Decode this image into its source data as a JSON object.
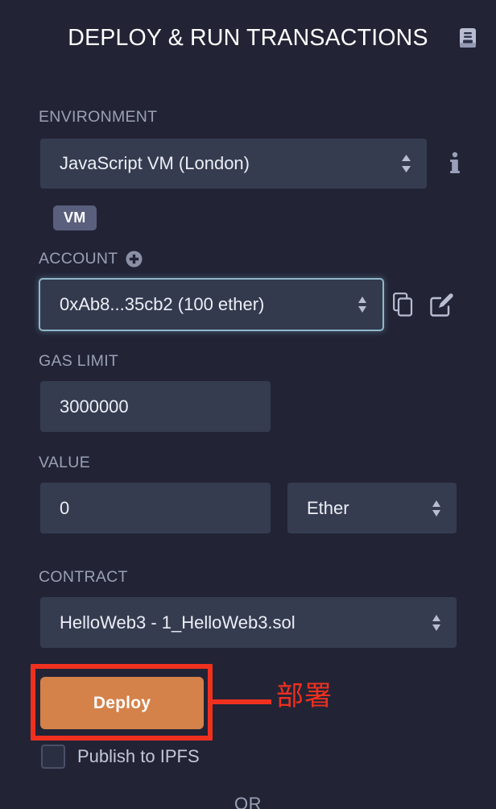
{
  "header": {
    "title": "DEPLOY & RUN TRANSACTIONS",
    "doc_icon": "book-icon"
  },
  "environment": {
    "label": "ENVIRONMENT",
    "value": "JavaScript VM (London)",
    "info_icon": "info-icon",
    "badge": "VM"
  },
  "account": {
    "label": "ACCOUNT",
    "add_icon": "plus-circle-icon",
    "value": "0xAb8...35cb2 (100 ether)",
    "copy_icon": "copy-icon",
    "edit_icon": "edit-icon"
  },
  "gas_limit": {
    "label": "GAS LIMIT",
    "value": "3000000"
  },
  "value": {
    "label": "VALUE",
    "amount": "0",
    "unit": "Ether"
  },
  "contract": {
    "label": "CONTRACT",
    "value": "HelloWeb3 - 1_HelloWeb3.sol"
  },
  "deploy": {
    "label": "Deploy"
  },
  "ipfs": {
    "label": "Publish to IPFS",
    "checked": false
  },
  "divider": {
    "or_label": "OR"
  },
  "annotation": {
    "text": "部署",
    "color": "#f0301f"
  },
  "colors": {
    "background": "#222436",
    "control_background": "#363c50",
    "label": "#9aa0b4",
    "text": "#eceef5",
    "deploy_orange": "#d4814a",
    "badge": "#5a5f7d",
    "focus_ring": "#8fb8c9",
    "annotation_red": "#f0301f"
  }
}
